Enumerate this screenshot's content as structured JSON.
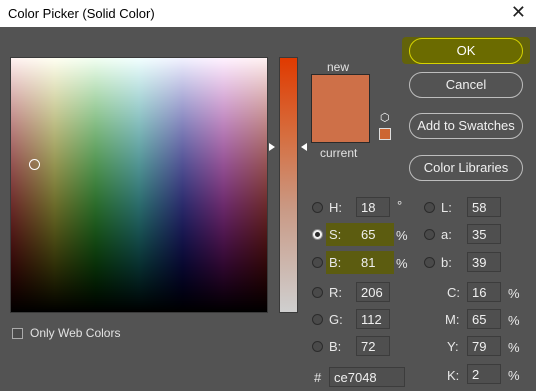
{
  "window": {
    "title": "Color Picker (Solid Color)",
    "close_glyph": "✕"
  },
  "swatch": {
    "new_label": "new",
    "current_label": "current",
    "new_color": "#ce7048",
    "current_color": "#ce7048",
    "cube_icon": "⬡"
  },
  "buttons": {
    "ok": "OK",
    "cancel": "Cancel",
    "add_to_swatches": "Add to Swatches",
    "color_libraries": "Color Libraries"
  },
  "fields": {
    "H": {
      "label": "H:",
      "value": "18",
      "unit": "°"
    },
    "S": {
      "label": "S:",
      "value": "65",
      "unit": "%"
    },
    "B": {
      "label": "B:",
      "value": "81",
      "unit": "%"
    },
    "R": {
      "label": "R:",
      "value": "206"
    },
    "G": {
      "label": "G:",
      "value": "112"
    },
    "Bl": {
      "label": "B:",
      "value": "72"
    },
    "L": {
      "label": "L:",
      "value": "58"
    },
    "a": {
      "label": "a:",
      "value": "35"
    },
    "b": {
      "label": "b:",
      "value": "39"
    },
    "C": {
      "label": "C:",
      "value": "16",
      "unit": "%"
    },
    "M": {
      "label": "M:",
      "value": "65",
      "unit": "%"
    },
    "Y": {
      "label": "Y:",
      "value": "79",
      "unit": "%"
    },
    "K": {
      "label": "K:",
      "value": "2",
      "unit": "%"
    }
  },
  "hex": {
    "label": "#",
    "value": "ce7048"
  },
  "web_colors": {
    "label": "Only Web Colors",
    "checked": false
  },
  "selected_mode": "S",
  "colors": {
    "highlight": "#5c5c10",
    "ok_accent": "#d6d300",
    "background": "#535353"
  }
}
